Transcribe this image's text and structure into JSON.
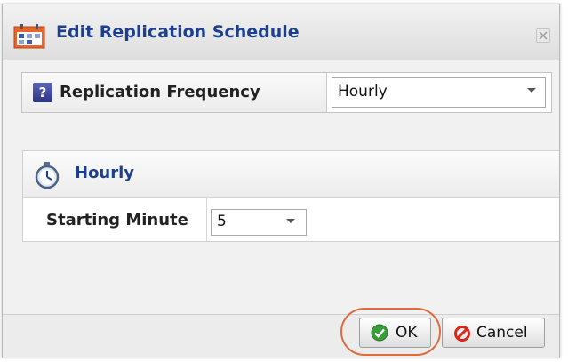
{
  "dialog": {
    "title": "Edit Replication Schedule",
    "title_icon": "schedule-calendar-icon",
    "close_icon": "close-icon"
  },
  "frequency": {
    "label": "Replication Frequency",
    "help_icon": "help-icon",
    "help_glyph": "?",
    "selected": "Hourly"
  },
  "hourly": {
    "title": "Hourly",
    "icon": "stopwatch-icon",
    "starting_minute_label": "Starting Minute",
    "starting_minute_value": "5"
  },
  "buttons": {
    "ok_label": "OK",
    "cancel_label": "Cancel",
    "ok_icon": "checkmark-icon",
    "cancel_icon": "cancel-icon"
  },
  "colors": {
    "title_text": "#1d3f8f",
    "ok_green": "#3a9c3a",
    "cancel_red": "#d9261c",
    "highlight": "#e06a3c"
  }
}
